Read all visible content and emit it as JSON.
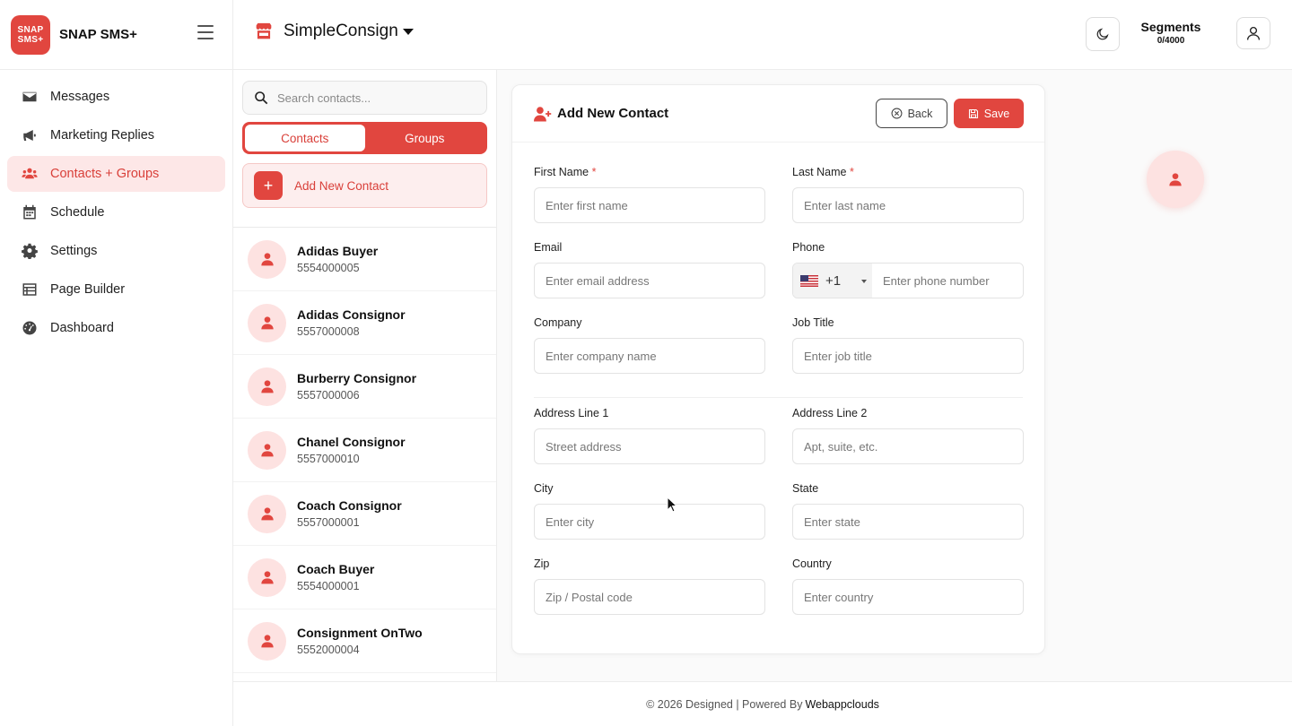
{
  "app": {
    "logo_line1": "SNAP",
    "logo_line2": "SMS+",
    "name": "SNAP SMS+"
  },
  "sidebar": {
    "items": [
      {
        "label": "Messages",
        "icon": "envelope-icon",
        "active": false
      },
      {
        "label": "Marketing Replies",
        "icon": "megaphone-icon",
        "active": false
      },
      {
        "label": "Contacts + Groups",
        "icon": "users-icon",
        "active": true
      },
      {
        "label": "Schedule",
        "icon": "calendar-icon",
        "active": false
      },
      {
        "label": "Settings",
        "icon": "gear-icon",
        "active": false
      },
      {
        "label": "Page Builder",
        "icon": "table-icon",
        "active": false
      },
      {
        "label": "Dashboard",
        "icon": "gauge-icon",
        "active": false
      }
    ]
  },
  "header": {
    "store_name": "SimpleConsign",
    "segments_title": "Segments",
    "segments_value": "0/4000"
  },
  "contacts_panel": {
    "search_placeholder": "Search contacts...",
    "tabs": [
      {
        "label": "Contacts",
        "active": true
      },
      {
        "label": "Groups",
        "active": false
      }
    ],
    "add_label": "Add New Contact",
    "contacts": [
      {
        "name": "Adidas Buyer",
        "phone": "5554000005"
      },
      {
        "name": "Adidas Consignor",
        "phone": "5557000008"
      },
      {
        "name": "Burberry Consignor",
        "phone": "5557000006"
      },
      {
        "name": "Chanel Consignor",
        "phone": "5557000010"
      },
      {
        "name": "Coach Consignor",
        "phone": "5557000001"
      },
      {
        "name": "Coach Buyer",
        "phone": "5554000001"
      },
      {
        "name": "Consignment OnTwo",
        "phone": "5552000004"
      }
    ]
  },
  "form": {
    "title": "Add New Contact",
    "back_label": "Back",
    "save_label": "Save",
    "first_name": {
      "label": "First Name",
      "required": "*",
      "placeholder": "Enter first name",
      "value": ""
    },
    "last_name": {
      "label": "Last Name",
      "required": "*",
      "placeholder": "Enter last name",
      "value": ""
    },
    "email": {
      "label": "Email",
      "placeholder": "Enter email address",
      "value": ""
    },
    "phone": {
      "label": "Phone",
      "country_code": "+1",
      "placeholder": "Enter phone number",
      "value": ""
    },
    "company": {
      "label": "Company",
      "placeholder": "Enter company name",
      "value": ""
    },
    "job_title": {
      "label": "Job Title",
      "placeholder": "Enter job title",
      "value": ""
    },
    "address1": {
      "label": "Address Line 1",
      "placeholder": "Street address",
      "value": ""
    },
    "address2": {
      "label": "Address Line 2",
      "placeholder": "Apt, suite, etc.",
      "value": ""
    },
    "city": {
      "label": "City",
      "placeholder": "Enter city",
      "value": ""
    },
    "state": {
      "label": "State",
      "placeholder": "Enter state",
      "value": ""
    },
    "zip": {
      "label": "Zip",
      "placeholder": "Zip / Postal code",
      "value": ""
    },
    "country": {
      "label": "Country",
      "placeholder": "Enter country",
      "value": ""
    }
  },
  "footer": {
    "text": "© 2026 Designed | Powered By",
    "powered_by": "Webappclouds"
  },
  "colors": {
    "accent": "#e1463f",
    "accent_light": "#fde7e7"
  }
}
